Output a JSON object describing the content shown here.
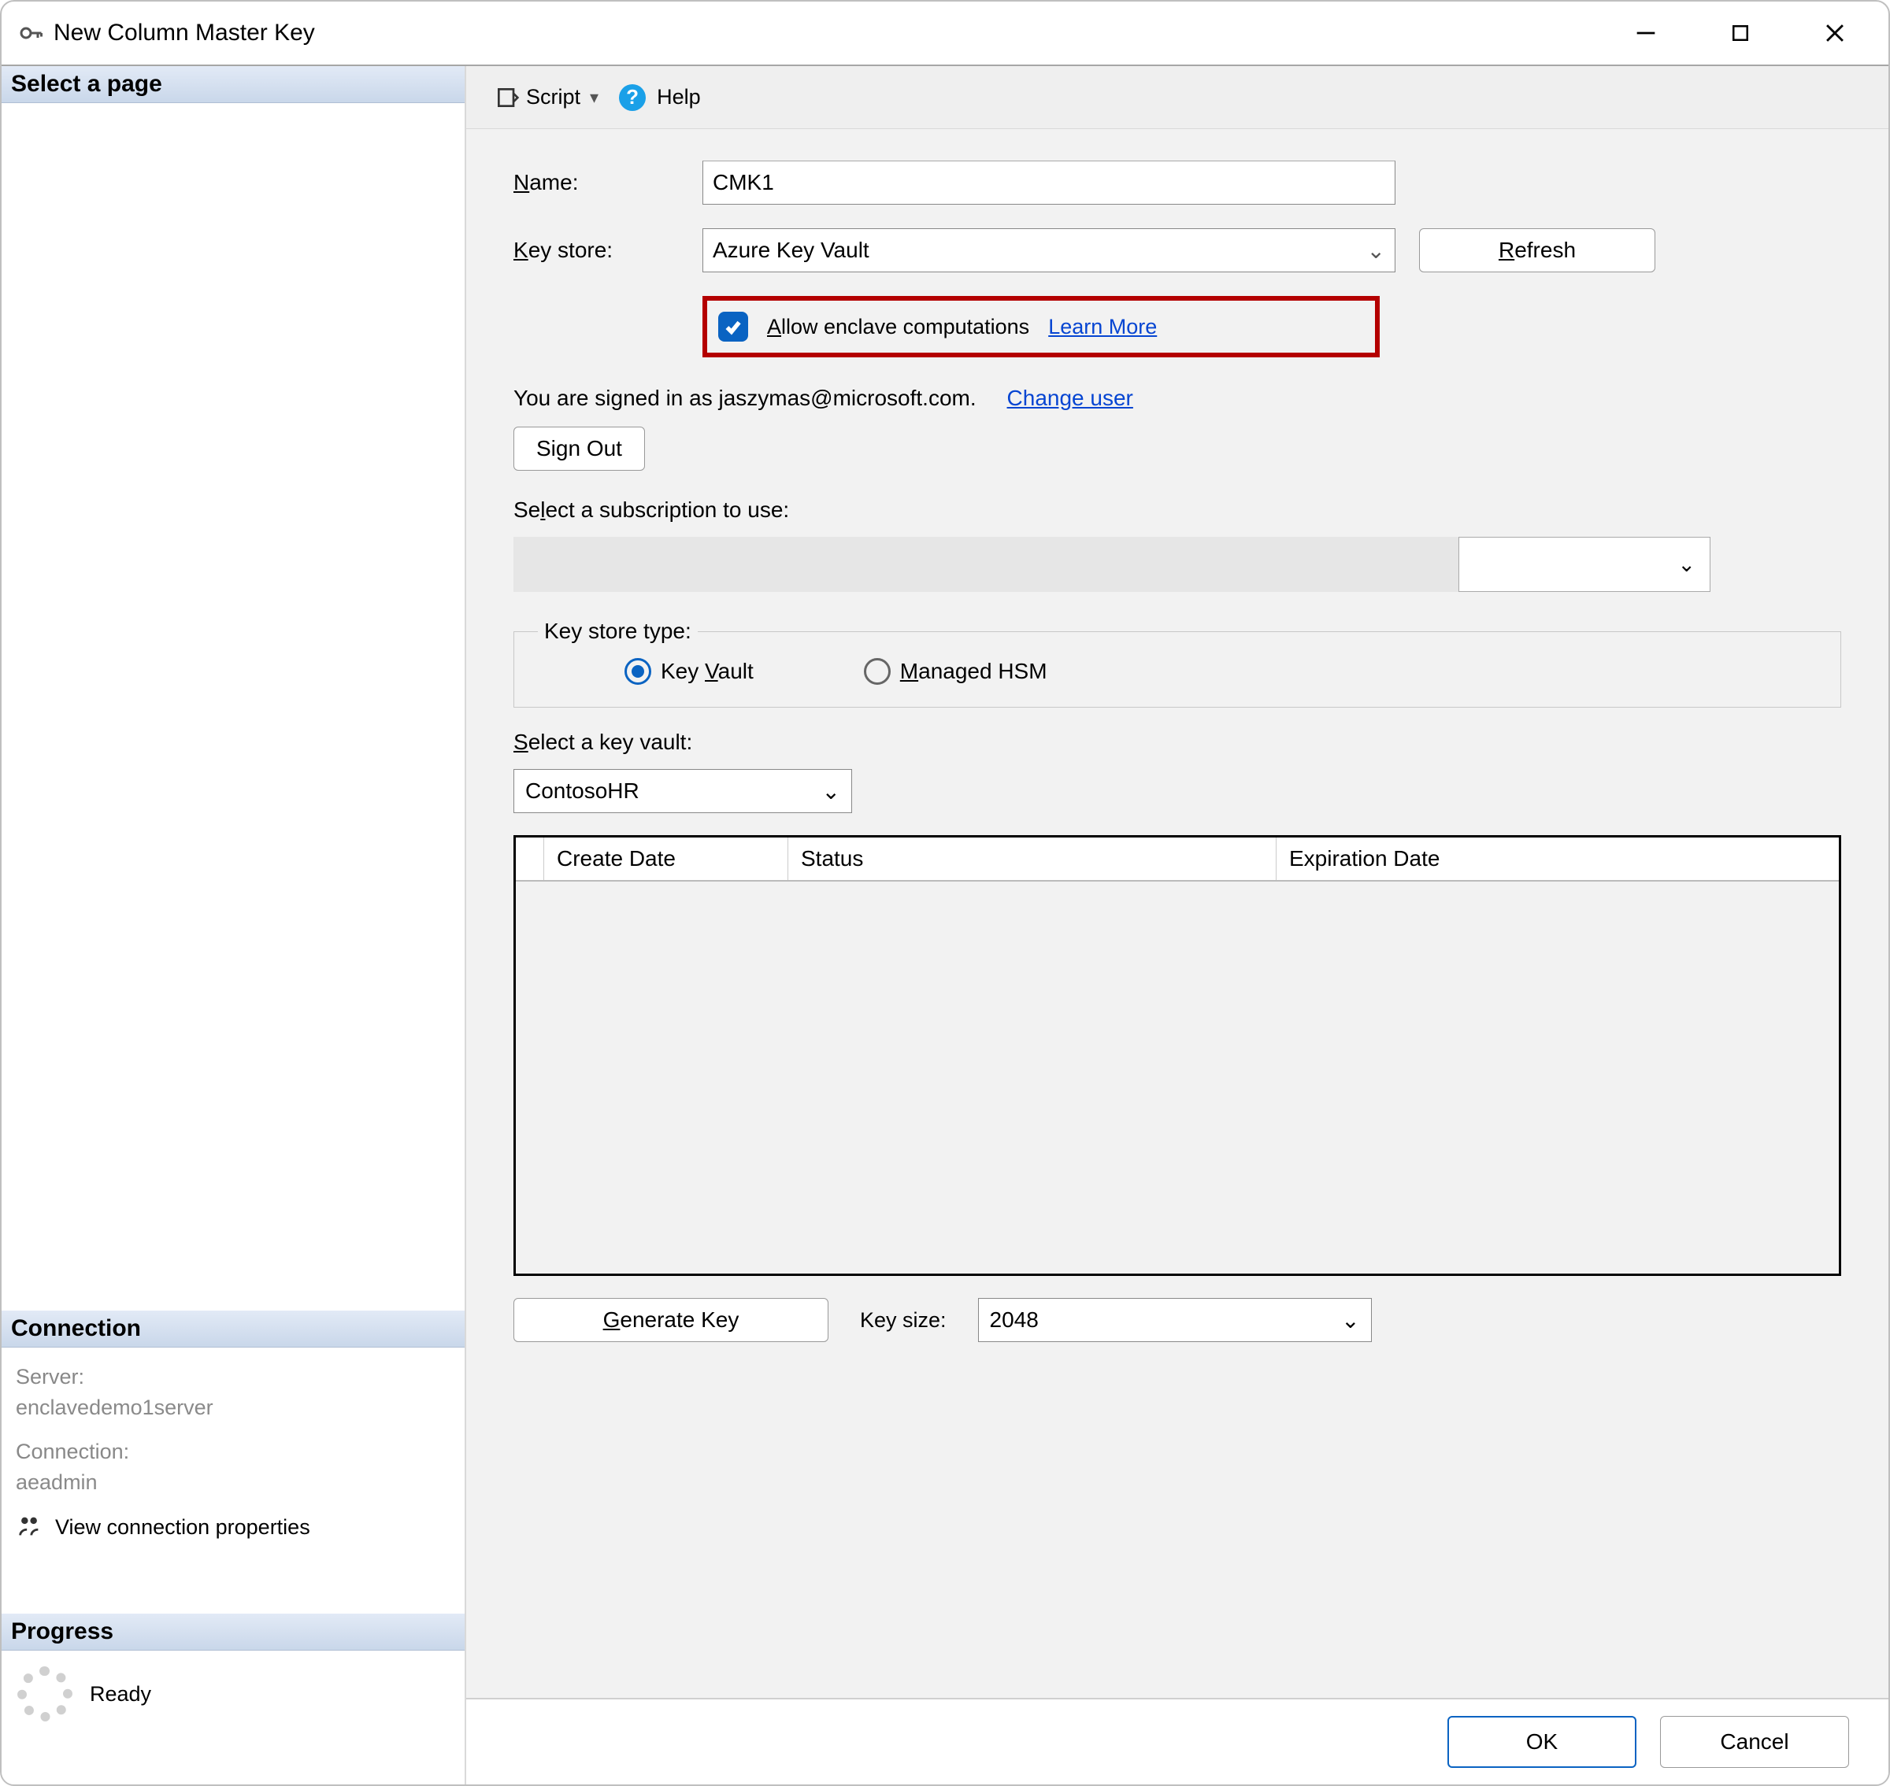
{
  "window": {
    "title": "New Column Master Key"
  },
  "sidebar": {
    "select_page_header": "Select a page",
    "connection_header": "Connection",
    "server_label": "Server:",
    "server_value": "enclavedemo1server",
    "connection_label": "Connection:",
    "connection_value": "aeadmin",
    "view_props": "View connection properties",
    "progress_header": "Progress",
    "progress_status": "Ready"
  },
  "toolbar": {
    "script_label": "Script",
    "help_label": "Help"
  },
  "form": {
    "name_label_pre": "N",
    "name_label_post": "ame:",
    "name_value": "CMK1",
    "keystore_label_pre": "K",
    "keystore_label_post": "ey store:",
    "keystore_value": "Azure Key Vault",
    "refresh_pre": "R",
    "refresh_post": "efresh",
    "allow_enclave_pre": "A",
    "allow_enclave_post": "llow enclave computations",
    "learn_more": "Learn More",
    "signed_in_text": "You are signed in as jaszymas@microsoft.com.",
    "change_user": "Change user",
    "sign_out": "Sign Out",
    "sub_label_pre": "Se",
    "sub_label_mid": "l",
    "sub_label_post": "ect a subscription to use:",
    "keystore_type_legend": "Key store type:",
    "radio_keyvault_pre": "Key ",
    "radio_keyvault_mid": "V",
    "radio_keyvault_post": "ault",
    "radio_mhsm_pre": "M",
    "radio_mhsm_post": "anaged HSM",
    "select_kv_label_pre": "S",
    "select_kv_label_post": "elect a key vault:",
    "kv_value": "ContosoHR",
    "col_create": "Create Date",
    "col_status": "Status",
    "col_exp": "Expiration Date",
    "gen_key_pre": "G",
    "gen_key_post": "enerate Key",
    "key_size_label": "Key size:",
    "key_size_value": "2048"
  },
  "footer": {
    "ok": "OK",
    "cancel": "Cancel"
  }
}
